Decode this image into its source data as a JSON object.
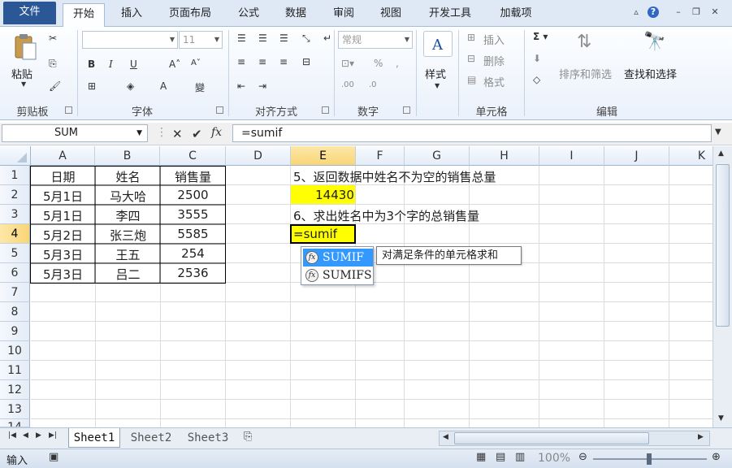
{
  "ribbon_tabs": [
    "文件",
    "开始",
    "插入",
    "页面布局",
    "公式",
    "数据",
    "审阅",
    "视图",
    "开发工具",
    "加载项"
  ],
  "clipboard": {
    "paste": "粘贴",
    "label": "剪贴板"
  },
  "font": {
    "size": "11",
    "label": "字体"
  },
  "alignment": {
    "label": "对齐方式"
  },
  "number": {
    "format": "常规",
    "label": "数字"
  },
  "styles": {
    "label": "样式"
  },
  "cells": {
    "insert": "插入",
    "delete": "删除",
    "format": "格式",
    "label": "单元格"
  },
  "editing": {
    "sort_filter": "排序和筛选",
    "find_select": "查找和选择",
    "label": "编辑"
  },
  "formula_bar": {
    "name_box": "SUM",
    "formula": "=sumif"
  },
  "columns": [
    "A",
    "B",
    "C",
    "D",
    "E",
    "F",
    "G",
    "H",
    "I",
    "J",
    "K"
  ],
  "rows": [
    "1",
    "2",
    "3",
    "4",
    "5",
    "6",
    "7",
    "8",
    "9",
    "10",
    "11",
    "12",
    "13",
    "14"
  ],
  "table": {
    "headers": [
      "日期",
      "姓名",
      "销售量"
    ],
    "rows": [
      [
        "5月1日",
        "马大哈",
        "2500"
      ],
      [
        "5月1日",
        "李四",
        "3555"
      ],
      [
        "5月2日",
        "张三炮",
        "5585"
      ],
      [
        "5月3日",
        "王五",
        "254"
      ],
      [
        "5月3日",
        "吕二",
        "2536"
      ]
    ]
  },
  "notes": {
    "q5": "5、返回数据中姓名不为空的销售总量",
    "q5_answer": "14430",
    "q6": "6、求出姓名中为3个字的总销售量",
    "editing_cell": "=sumif"
  },
  "autocomplete": {
    "items": [
      "SUMIF",
      "SUMIFS"
    ],
    "tooltip": "对满足条件的单元格求和"
  },
  "sheets": [
    "Sheet1",
    "Sheet2",
    "Sheet3"
  ],
  "status": {
    "mode": "输入",
    "zoom": "100%"
  },
  "colors": {
    "highlight": "#ffff00",
    "accent": "#2b5797"
  }
}
